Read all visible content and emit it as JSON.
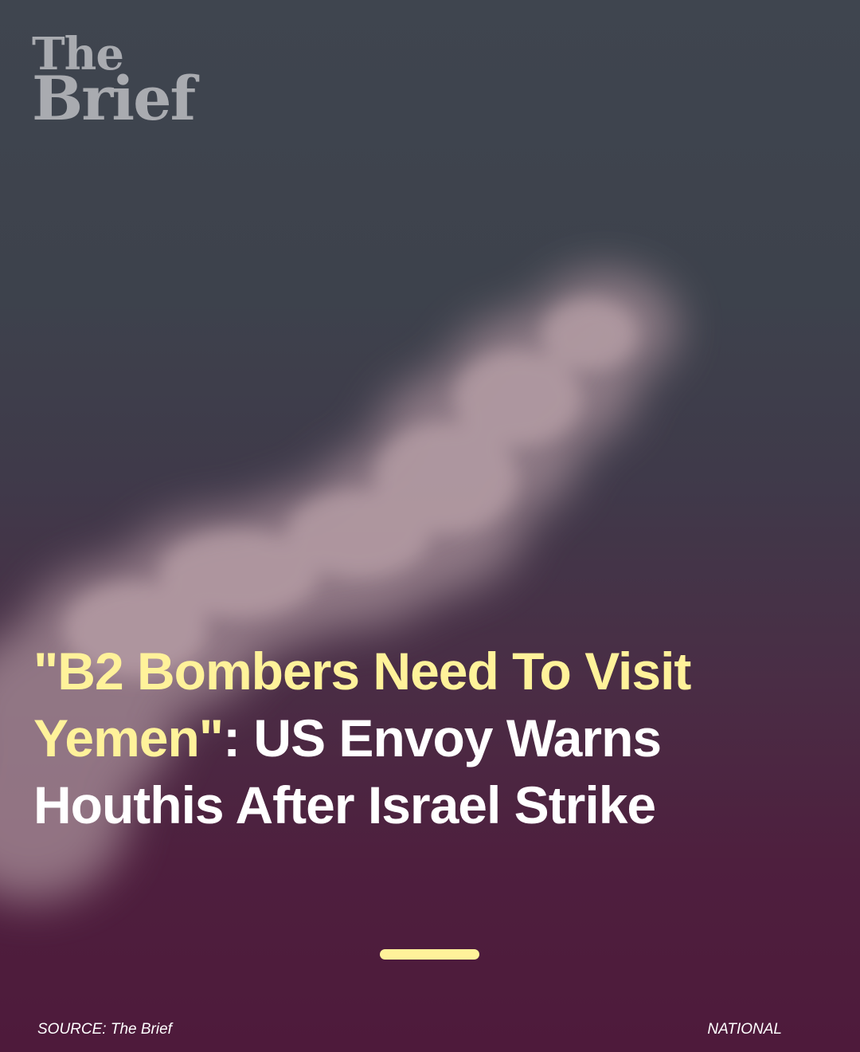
{
  "logo": {
    "line1": "The",
    "line2": "Brief"
  },
  "headline": {
    "quote": "\"B2 Bombers Need To Visit Yemen\"",
    "rest": ": US Envoy Warns Houthis After Israel Strike"
  },
  "footer": {
    "source": "SOURCE: The Brief",
    "category": "NATIONAL"
  },
  "colors": {
    "accent": "#fff29a",
    "text": "#ffffff",
    "logo": "#a9abb0"
  }
}
